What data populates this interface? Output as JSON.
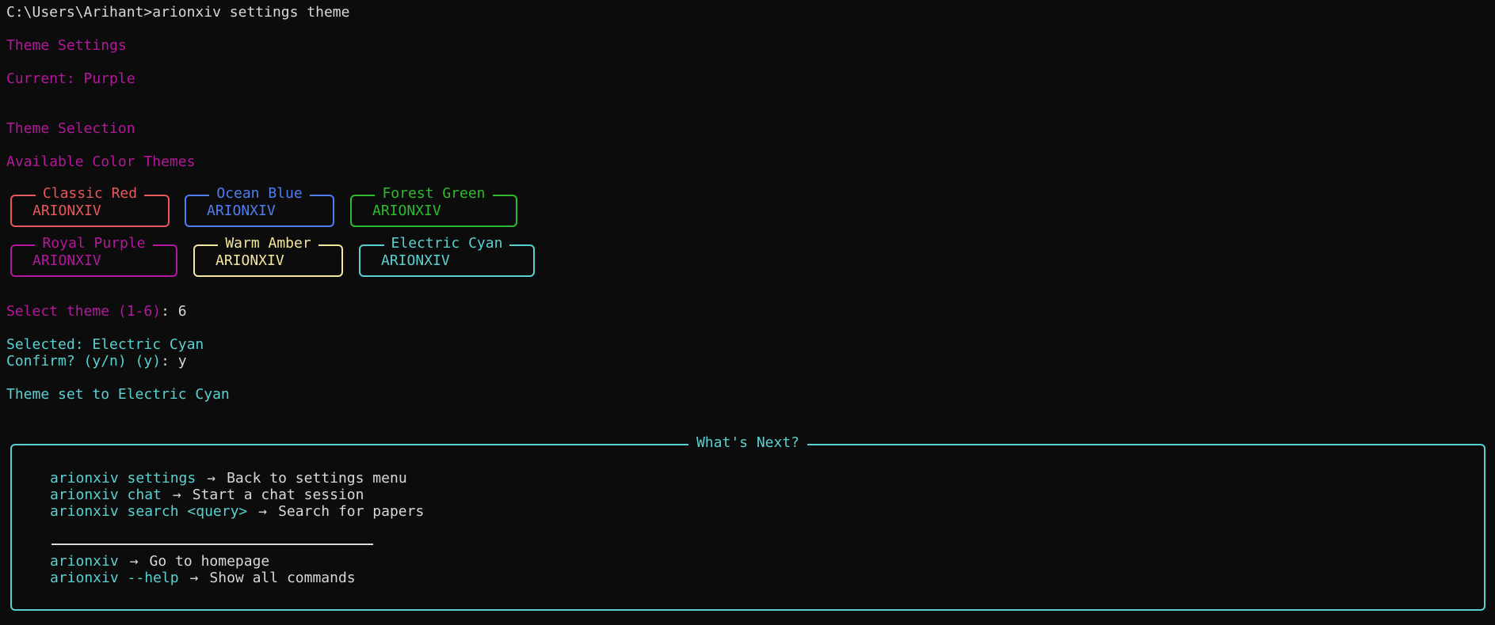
{
  "prompt": {
    "path": "C:\\Users\\Arihant>",
    "command": "arionxiv settings theme"
  },
  "header": {
    "title": "Theme Settings",
    "current": "Current: Purple"
  },
  "selection": {
    "title": "Theme Selection",
    "subtitle": "Available Color Themes"
  },
  "themes": [
    {
      "name": "Classic Red",
      "sample": "ARIONXIV",
      "color": "#e8575a"
    },
    {
      "name": "Ocean Blue",
      "sample": "ARIONXIV",
      "color": "#4f7df0"
    },
    {
      "name": "Forest Green",
      "sample": "ARIONXIV",
      "color": "#2fbb2f"
    },
    {
      "name": "Royal Purple",
      "sample": "ARIONXIV",
      "color": "#b5179e"
    },
    {
      "name": "Warm Amber",
      "sample": "ARIONXIV",
      "color": "#f5e6a0"
    },
    {
      "name": "Electric Cyan",
      "sample": "ARIONXIV",
      "color": "#5ad1d1"
    }
  ],
  "interaction": {
    "select_prompt": "Select theme (1-6)",
    "select_sep": ": ",
    "select_value": "6",
    "selected": "Selected: Electric Cyan",
    "confirm_prompt": "Confirm? (y/n) (y)",
    "confirm_sep": ": ",
    "confirm_value": "y",
    "result": "Theme set to Electric Cyan"
  },
  "next_panel": {
    "title": "What's Next?",
    "arrow": "→",
    "commands": [
      {
        "cmd": "arionxiv settings",
        "desc": "Back to settings menu"
      },
      {
        "cmd": "arionxiv chat",
        "desc": "Start a chat session"
      },
      {
        "cmd": "arionxiv search <query>",
        "desc": "Search for papers"
      }
    ],
    "extra": [
      {
        "cmd": "arionxiv",
        "desc": "Go to homepage"
      },
      {
        "cmd": "arionxiv --help",
        "desc": "Show all commands"
      }
    ]
  },
  "colors": {
    "background": "#0c0c0c",
    "accent_purple": "#b5179e",
    "accent_cyan": "#5ad1d1",
    "text": "#d8d8d8"
  }
}
